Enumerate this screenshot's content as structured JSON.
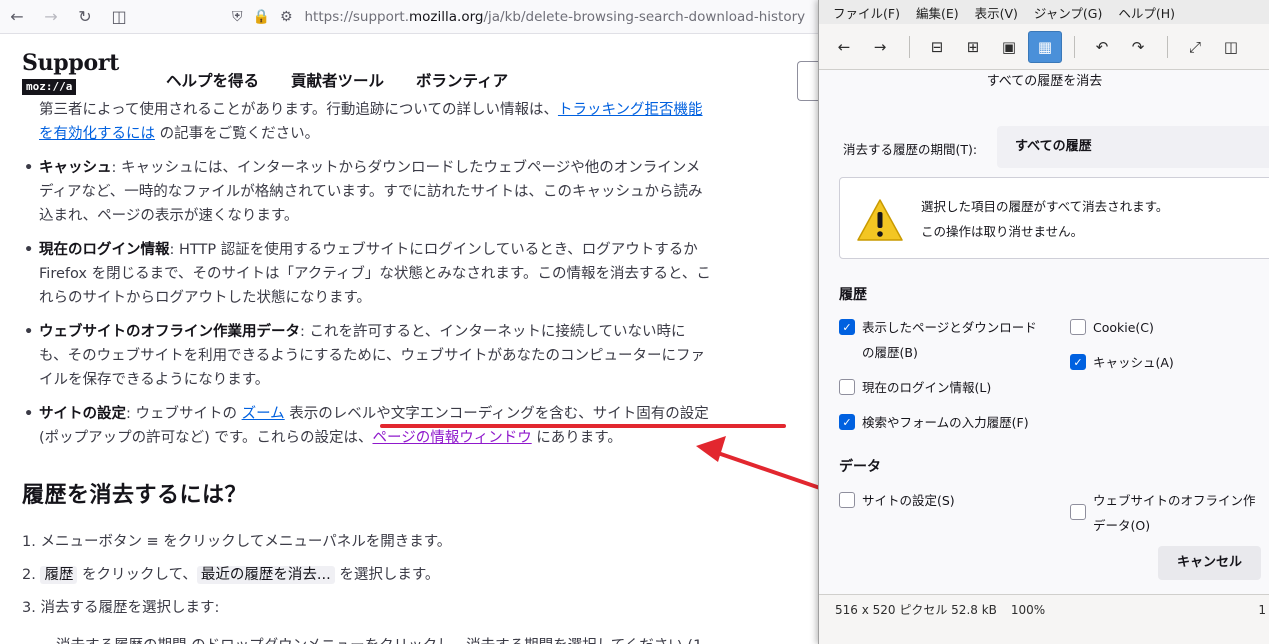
{
  "browser": {
    "url_prefix": "https://support.",
    "url_host": "mozilla.org",
    "url_path": "/ja/kb/delete-browsing-search-download-history-fire"
  },
  "site": {
    "logo_word": "Support",
    "logo_sub": "moz://a",
    "nav": [
      "ヘルプを得る",
      "貢献者ツール",
      "ボランティア"
    ]
  },
  "article": {
    "intro_line1": "第三者によって使用されることがあります。行動追跡についての詳しい情報は、",
    "intro_link1": "トラッキング拒否機能",
    "intro_link2": "を有効化するには",
    "intro_line2_tail": " の記事をご覧ください。",
    "bullets": [
      {
        "term": "キャッシュ",
        "lines": [
          ": キャッシュには、インターネットからダウンロードしたウェブページや他のオンラインメ",
          "ディアなど、一時的なファイルが格納されています。すでに訪れたサイトは、このキャッシュから読み",
          "込まれ、ページの表示が速くなります。"
        ]
      },
      {
        "term": "現在のログイン情報",
        "lines": [
          ": HTTP 認証を使用するウェブサイトにログインしているとき、ログアウトするか",
          "Firefox を閉じるまで、そのサイトは「アクティブ」な状態とみなされます。この情報を消去すると、こ",
          "れらのサイトからログアウトした状態になります。"
        ]
      },
      {
        "term": "ウェブサイトのオフライン作業用データ",
        "lines": [
          ": これを許可すると、インターネットに接続していない時に",
          "も、そのウェブサイトを利用できるようにするために、ウェブサイトがあなたのコンピューターにファ",
          "イルを保存できるようになります。"
        ]
      }
    ],
    "site_settings": {
      "term": "サイトの設定",
      "pre": ": ウェブサイトの ",
      "link_zoom": "ズーム",
      "mid": " 表示のレベルや文字エンコーディングを含む、サイト固有の設定",
      "line2_pre": "(ポップアップの許可など) です。これらの設定は、",
      "link_page_info": "ページの情報ウィンドウ",
      "line2_tail": " にあります。"
    },
    "heading": "履歴を消去するには？",
    "steps": {
      "s1_pre": "1. メニューボタン ≡ をクリックしてメニューパネルを開きます。",
      "s2_num": "2. ",
      "s2_kbd1": "履歴",
      "s2_mid": " をクリックして、",
      "s2_kbd2": "最近の履歴を消去...",
      "s2_tail": " を選択します。",
      "s3": "3. 消去する履歴を選択します:",
      "s3_cut": "消去する履歴の期間 のドロップダウンメニューをクリックし、消去する期間を選択してください (1"
    }
  },
  "viewer": {
    "menu": [
      "ファイル(F)",
      "編集(E)",
      "表示(V)",
      "ジャンプ(G)",
      "ヘルプ(H)"
    ],
    "status_info": "516 x 520 ピクセル 52.8 kB",
    "status_zoom": "100%",
    "status_right": "1"
  },
  "dialog": {
    "title": "すべての履歴を消去",
    "range_label": "消去する履歴の期間(T):",
    "range_value": "すべての履歴",
    "warn_line1": "選択した項目の履歴がすべて消去されます。",
    "warn_line2": "この操作は取り消せません。",
    "history_heading": "履歴",
    "data_heading": "データ",
    "cb_pages_1": "表示したページとダウンロード",
    "cb_pages_2": "の履歴(B)",
    "cb_cookie": "Cookie(C)",
    "cb_cache": "キャッシュ(A)",
    "cb_login": "現在のログイン情報(L)",
    "cb_forms": "検索やフォームの入力履歴(F)",
    "cb_site": "サイトの設定(S)",
    "cb_offline_1": "ウェブサイトのオフライン作",
    "cb_offline_2": "データ(O)",
    "cancel": "キャンセル"
  },
  "colors": {
    "annotation_red": "#e2272f",
    "link_blue": "#0060df",
    "visited_purple": "#8f19cc",
    "checkbox_blue": "#0061e0",
    "warning_yellow": "#f3c623"
  }
}
